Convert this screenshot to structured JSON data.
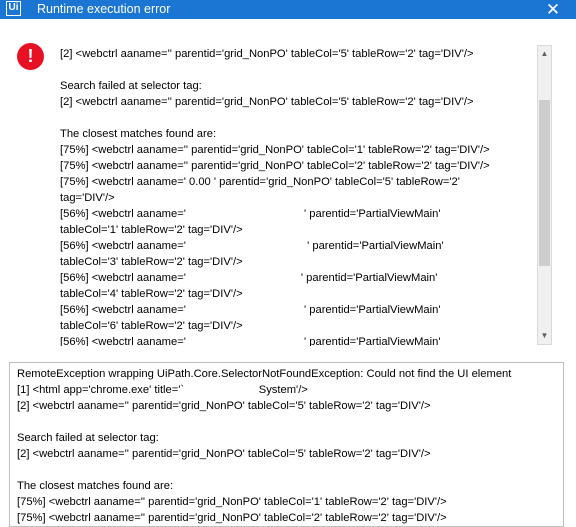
{
  "window": {
    "title": "Runtime execution error",
    "app_icon": "Ui",
    "close_glyph": "✕"
  },
  "icons": {
    "error": "!",
    "scroll_up": "▲",
    "scroll_down": "▼"
  },
  "message_lines": [
    "[2] <webctrl aaname='' parentid='grid_NonPO' tableCol='5' tableRow='2' tag='DIV'/>",
    "",
    "Search failed at selector tag:",
    "[2] <webctrl aaname='' parentid='grid_NonPO' tableCol='5' tableRow='2' tag='DIV'/>",
    "",
    "The closest matches found are:",
    "[75%] <webctrl aaname='' parentid='grid_NonPO' tableCol='1' tableRow='2' tag='DIV'/>",
    "[75%] <webctrl aaname='' parentid='grid_NonPO' tableCol='2' tableRow='2' tag='DIV'/>",
    "[75%] <webctrl aaname=' 0.00 ' parentid='grid_NonPO' tableCol='5' tableRow='2'",
    "tag='DIV'/>",
    "[56%] <webctrl aaname='                                      ' parentid='PartialViewMain'",
    "tableCol='1' tableRow='2' tag='DIV'/>",
    "[56%] <webctrl aaname='                                       ' parentid='PartialViewMain'",
    "tableCol='3' tableRow='2' tag='DIV'/>",
    "[56%] <webctrl aaname='                                     ' parentid='PartialViewMain'",
    "tableCol='4' tableRow='2' tag='DIV'/>",
    "[56%] <webctrl aaname='                                      ' parentid='PartialViewMain'",
    "tableCol='6' tableRow='2' tag='DIV'/>",
    "[56%] <webctrl aaname='                                      ' parentid='PartialViewMain'"
  ],
  "detail_lines": [
    "RemoteException wrapping UiPath.Core.SelectorNotFoundException: Could not find the UI element",
    "[1] <html app='chrome.exe' title='`                        System'/>",
    "[2] <webctrl aaname='' parentid='grid_NonPO' tableCol='5' tableRow='2' tag='DIV'/>",
    "",
    "Search failed at selector tag:",
    "[2] <webctrl aaname='' parentid='grid_NonPO' tableCol='5' tableRow='2' tag='DIV'/>",
    "",
    "The closest matches found are:",
    "[75%] <webctrl aaname='' parentid='grid_NonPO' tableCol='1' tableRow='2' tag='DIV'/>",
    "[75%] <webctrl aaname='' parentid='grid_NonPO' tableCol='2' tableRow='2' tag='DIV'/>"
  ]
}
